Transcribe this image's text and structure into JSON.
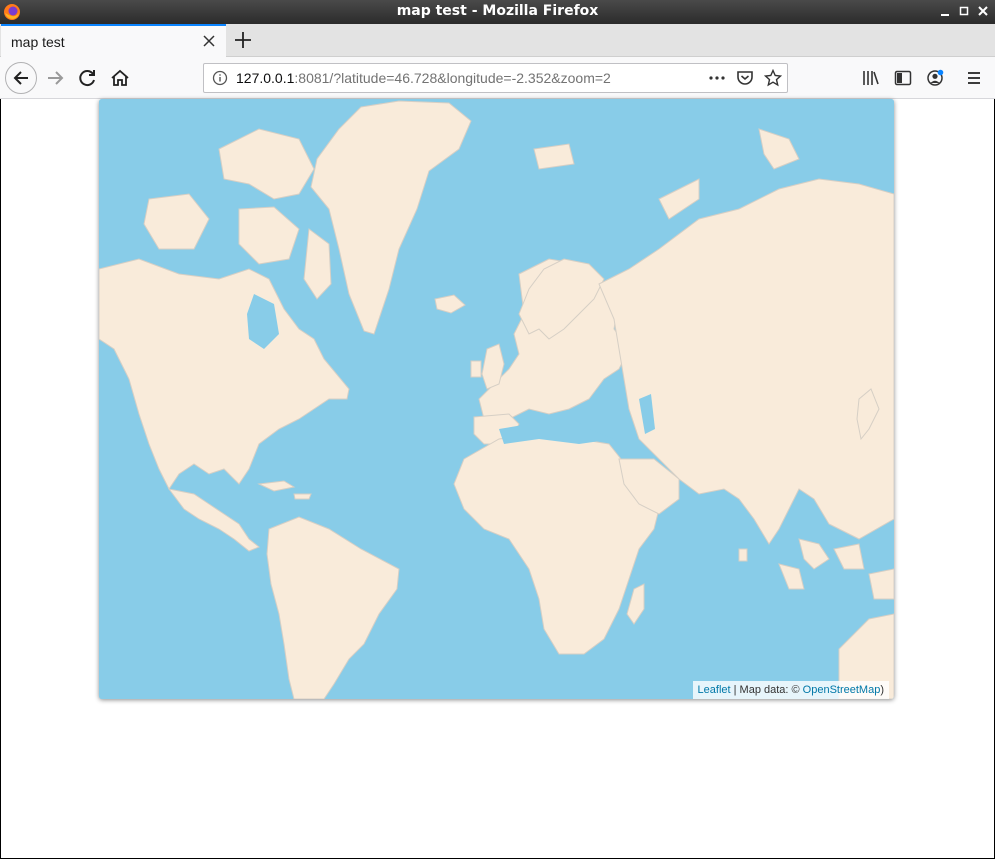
{
  "window": {
    "title": "map test - Mozilla Firefox"
  },
  "tabs": [
    {
      "label": "map test",
      "active": true
    }
  ],
  "navbar": {
    "url_host": "127.0.0.1",
    "url_rest": ":8081/?latitude=46.728&longitude=-2.352&zoom=2",
    "icons": [
      "back-icon",
      "forward-icon",
      "reload-icon",
      "home-icon",
      "info-icon",
      "more-icon",
      "pocket-icon",
      "bookmark-star-icon",
      "library-icon",
      "sidebar-icon",
      "account-icon",
      "menu-icon"
    ]
  },
  "map": {
    "latitude": 46.728,
    "longitude": -2.352,
    "zoom": 2,
    "colors": {
      "water": "#88cce8",
      "land": "#f9ebda",
      "border": "#d4cdc4"
    },
    "attribution": {
      "leaflet_link": "Leaflet",
      "separator": " | Map data: © ",
      "osm_link": "OpenStreetMap",
      "closing": ")"
    }
  }
}
